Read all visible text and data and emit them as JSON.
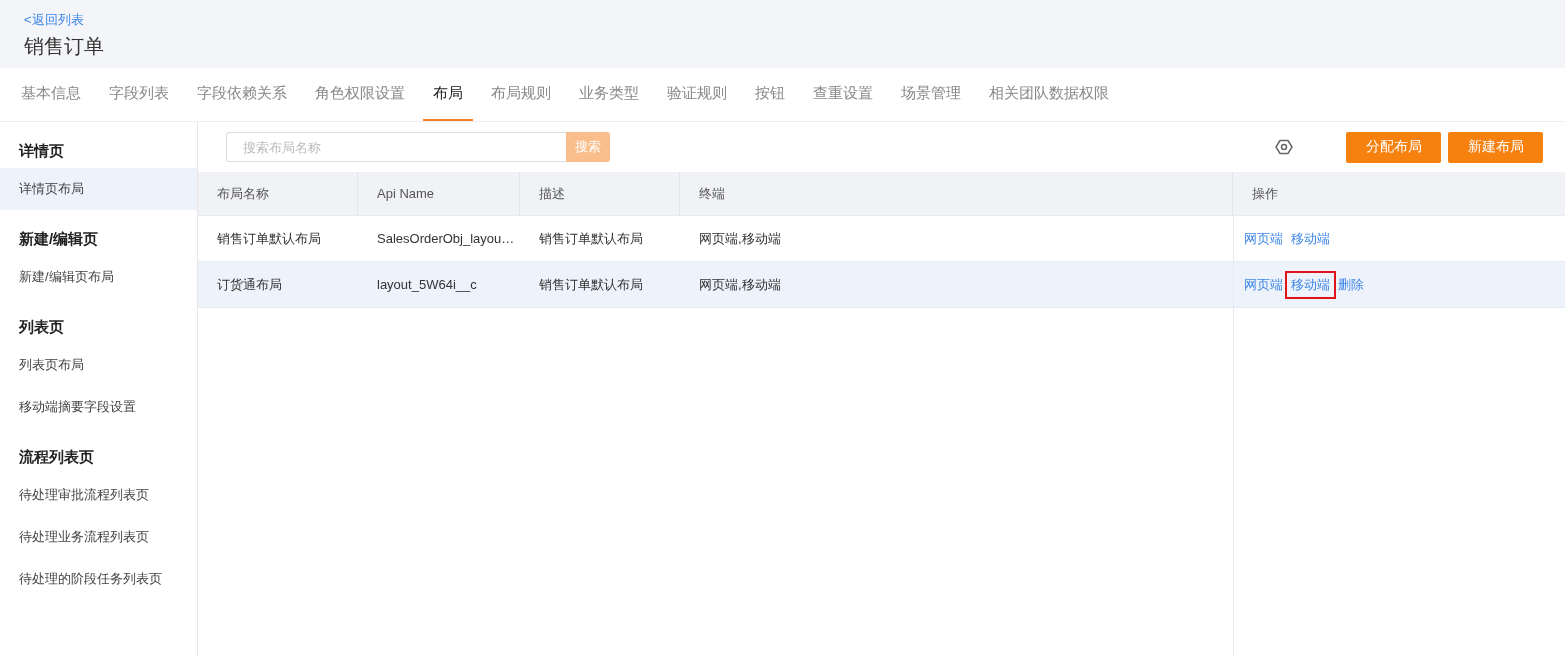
{
  "header": {
    "back_link": "<返回列表",
    "title": "销售订单"
  },
  "tabs": [
    {
      "label": "基本信息",
      "selected": false
    },
    {
      "label": "字段列表",
      "selected": false
    },
    {
      "label": "字段依赖关系",
      "selected": false
    },
    {
      "label": "角色权限设置",
      "selected": false
    },
    {
      "label": "布局",
      "selected": true
    },
    {
      "label": "布局规则",
      "selected": false
    },
    {
      "label": "业务类型",
      "selected": false
    },
    {
      "label": "验证规则",
      "selected": false
    },
    {
      "label": "按钮",
      "selected": false
    },
    {
      "label": "查重设置",
      "selected": false
    },
    {
      "label": "场景管理",
      "selected": false
    },
    {
      "label": "相关团队数据权限",
      "selected": false
    }
  ],
  "sidebar": {
    "sections": [
      {
        "title": "详情页",
        "items": [
          {
            "label": "详情页布局",
            "selected": true
          }
        ]
      },
      {
        "title": "新建/编辑页",
        "items": [
          {
            "label": "新建/编辑页布局",
            "selected": false
          }
        ]
      },
      {
        "title": "列表页",
        "items": [
          {
            "label": "列表页布局",
            "selected": false
          },
          {
            "label": "移动端摘要字段设置",
            "selected": false
          }
        ]
      },
      {
        "title": "流程列表页",
        "items": [
          {
            "label": "待处理审批流程列表页",
            "selected": false
          },
          {
            "label": "待处理业务流程列表页",
            "selected": false
          },
          {
            "label": "待处理的阶段任务列表页",
            "selected": false
          }
        ]
      }
    ]
  },
  "toolbar": {
    "search": {
      "placeholder": "搜索布局名称",
      "button": "搜索"
    },
    "buttons": [
      "分配布局",
      "新建布局"
    ]
  },
  "table": {
    "columns": [
      "布局名称",
      "Api Name",
      "描述",
      "终端",
      "操作"
    ],
    "rows": [
      {
        "cells": [
          "销售订单默认布局",
          "SalesOrderObj_layou…",
          "销售订单默认布局",
          "网页端,移动端"
        ],
        "hovered": false,
        "actions": [
          {
            "label": "网页端",
            "highlighted": false
          },
          {
            "label": "移动端",
            "highlighted": false
          }
        ]
      },
      {
        "cells": [
          "订货通布局",
          "layout_5W64i__c",
          "销售订单默认布局",
          "网页端,移动端"
        ],
        "hovered": true,
        "actions": [
          {
            "label": "网页端",
            "highlighted": false
          },
          {
            "label": "移动端",
            "highlighted": true
          },
          {
            "label": "删除",
            "highlighted": false
          }
        ]
      }
    ]
  }
}
